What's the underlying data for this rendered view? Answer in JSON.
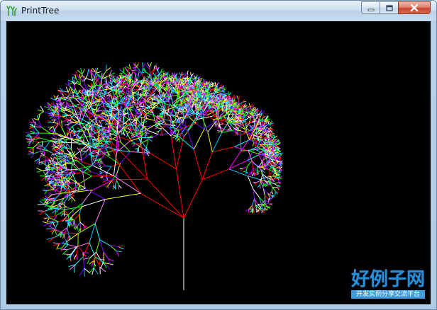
{
  "window": {
    "title": "PrintTree",
    "app_icon": "fork-icon",
    "controls": {
      "minimize_icon": "minimize-icon",
      "maximize_icon": "maximize-icon",
      "close_icon": "close-icon"
    }
  },
  "canvas": {
    "background": "#000000",
    "palette": [
      "#ff0000",
      "#00ff00",
      "#ff00ff",
      "#00ffff",
      "#ffff00",
      "#8000ff",
      "#ff80ff",
      "#80ff00",
      "#ffffff",
      "#00c0ff"
    ],
    "trunk_color": "#ffffff",
    "main_branch_color": "#ff0000"
  },
  "watermark": {
    "main": "好例子网",
    "sub": "开发实例分享交流平台"
  }
}
